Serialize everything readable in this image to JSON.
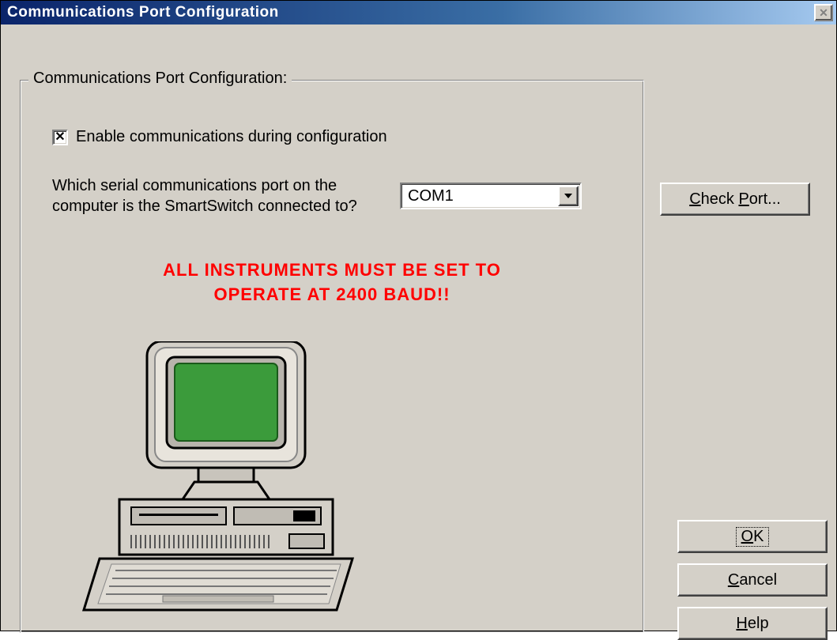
{
  "window": {
    "title": "Communications Port Configuration"
  },
  "groupbox": {
    "legend": "Communications Port Configuration:"
  },
  "checkbox": {
    "checked_glyph": "✕",
    "label": "Enable communications during configuration"
  },
  "question": {
    "text": "Which serial communications port on the computer is the SmartSwitch connected to?"
  },
  "combo": {
    "value": "COM1"
  },
  "warning": {
    "text": "ALL INSTRUMENTS MUST BE SET TO\nOPERATE AT 2400 BAUD!!"
  },
  "buttons": {
    "check_port": "Check Port...",
    "ok": "OK",
    "cancel": "Cancel",
    "help": "Help"
  }
}
